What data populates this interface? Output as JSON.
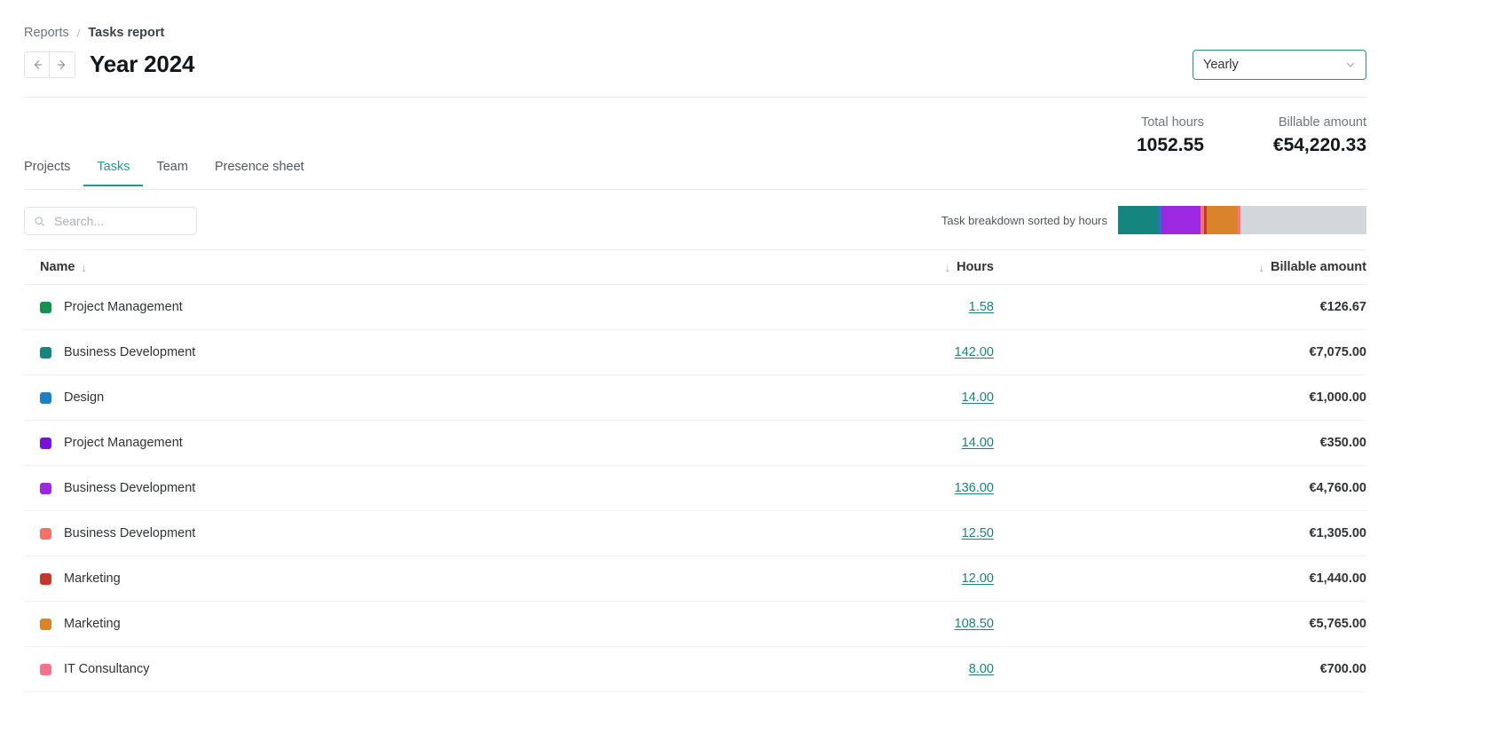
{
  "breadcrumb": {
    "root": "Reports",
    "separator": "/",
    "current": "Tasks report"
  },
  "header": {
    "prev_icon": "arrow-left-icon",
    "next_icon": "arrow-right-icon",
    "title": "Year 2024",
    "period_select": {
      "value": "Yearly",
      "chevron_icon": "chevron-down-icon",
      "border_color": "#2a8d8a"
    }
  },
  "stats": [
    {
      "label": "Total hours",
      "value": "1052.55"
    },
    {
      "label": "Billable amount",
      "value": "€54,220.33"
    }
  ],
  "tabs": [
    {
      "label": "Projects",
      "active": false
    },
    {
      "label": "Tasks",
      "active": true
    },
    {
      "label": "Team",
      "active": false
    },
    {
      "label": "Presence sheet",
      "active": false
    }
  ],
  "accent_color": "#1f9a96",
  "search": {
    "icon": "search-icon",
    "value": "",
    "placeholder": "Search..."
  },
  "breakdown": {
    "label": "Task breakdown sorted by hours",
    "track_color": "#d3d7dc",
    "segments": [
      {
        "color": "#15857f",
        "width_pct": 16.2
      },
      {
        "color": "#2d72c8",
        "width_pct": 1.4
      },
      {
        "color": "#9b27e0",
        "width_pct": 15.5
      },
      {
        "color": "#f37169",
        "width_pct": 1.4
      },
      {
        "color": "#c0392b",
        "width_pct": 1.4
      },
      {
        "color": "#d9832b",
        "width_pct": 12.4
      },
      {
        "color": "#f8718b",
        "width_pct": 0.9
      }
    ]
  },
  "table": {
    "columns": [
      {
        "key": "name",
        "label": "Name",
        "sort_icon": "↓",
        "sort_before": false
      },
      {
        "key": "hours",
        "label": "Hours",
        "sort_icon": "↓",
        "sort_before": true
      },
      {
        "key": "amount",
        "label": "Billable amount",
        "sort_icon": "↓",
        "sort_before": true
      }
    ],
    "rows": [
      {
        "color": "#12914f",
        "name": "Project Management",
        "hours": "1.58",
        "amount": "€126.67"
      },
      {
        "color": "#15857f",
        "name": "Business Development",
        "hours": "142.00",
        "amount": "€7,075.00"
      },
      {
        "color": "#1b81c4",
        "name": "Design",
        "hours": "14.00",
        "amount": "€1,000.00"
      },
      {
        "color": "#7a10de",
        "name": "Project Management",
        "hours": "14.00",
        "amount": "€350.00"
      },
      {
        "color": "#9b27e0",
        "name": "Business Development",
        "hours": "136.00",
        "amount": "€4,760.00"
      },
      {
        "color": "#f37169",
        "name": "Business Development",
        "hours": "12.50",
        "amount": "€1,305.00"
      },
      {
        "color": "#c0392b",
        "name": "Marketing",
        "hours": "12.00",
        "amount": "€1,440.00"
      },
      {
        "color": "#d9832b",
        "name": "Marketing",
        "hours": "108.50",
        "amount": "€5,765.00"
      },
      {
        "color": "#f8718b",
        "name": "IT Consultancy",
        "hours": "8.00",
        "amount": "€700.00"
      }
    ]
  }
}
